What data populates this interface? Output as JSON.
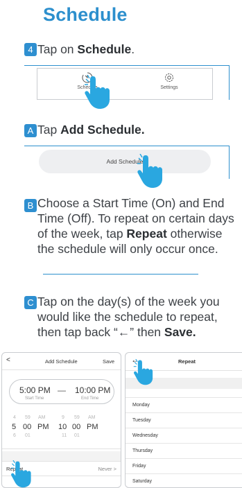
{
  "page": {
    "title": "Schedule"
  },
  "colors": {
    "accent": "#2c8fcd",
    "badge": "#2e8fd0",
    "hand": "#2aa7e0"
  },
  "steps": {
    "s4": {
      "badge": "4",
      "prefix": "Tap on ",
      "bold": "Schedule",
      "suffix": "."
    },
    "sA": {
      "badge": "A",
      "prefix": "Tap ",
      "bold": "Add Schedule.",
      "suffix": ""
    },
    "sB": {
      "badge": "B",
      "lines": [
        "Choose a Start Time (On) and End",
        "Time (Off). To repeat on certain days",
        "of the week, tap ",
        "Repeat",
        " otherwise",
        "the schedule will only occur once."
      ]
    },
    "sC": {
      "badge": "C",
      "lines": [
        "Tap on the day(s) of the week you",
        "would like the schedule to repeat,",
        "then tap back “",
        "←",
        "” then ",
        "Save."
      ]
    }
  },
  "tabbar": {
    "schedule_label": "Schedule",
    "settings_label": "Settings",
    "schedule_icon": "clock-icon",
    "settings_icon": "gear-icon"
  },
  "add_schedule": {
    "button_label": "Add Schedule"
  },
  "phone_left": {
    "back_glyph": "<",
    "title": "Add Schedule",
    "save_label": "Save",
    "start_time": "5:00 PM",
    "dash": "—",
    "end_time": "10:00 PM",
    "start_label": "Start Time",
    "end_label": "End Time",
    "wheel": {
      "top": [
        "4",
        "59",
        "AM",
        "9",
        "59",
        "AM"
      ],
      "mid": [
        "5",
        "00",
        "PM",
        "10",
        "00",
        "PM"
      ],
      "bot": [
        "6",
        "01",
        "",
        "11",
        "01",
        ""
      ]
    },
    "repeat_label": "Repeat",
    "repeat_value": "Never >"
  },
  "phone_right": {
    "back_glyph": "←",
    "title": "Repeat",
    "days": [
      "Monday",
      "Tuesday",
      "Wednesday",
      "Thursday",
      "Friday",
      "Saturday"
    ]
  }
}
